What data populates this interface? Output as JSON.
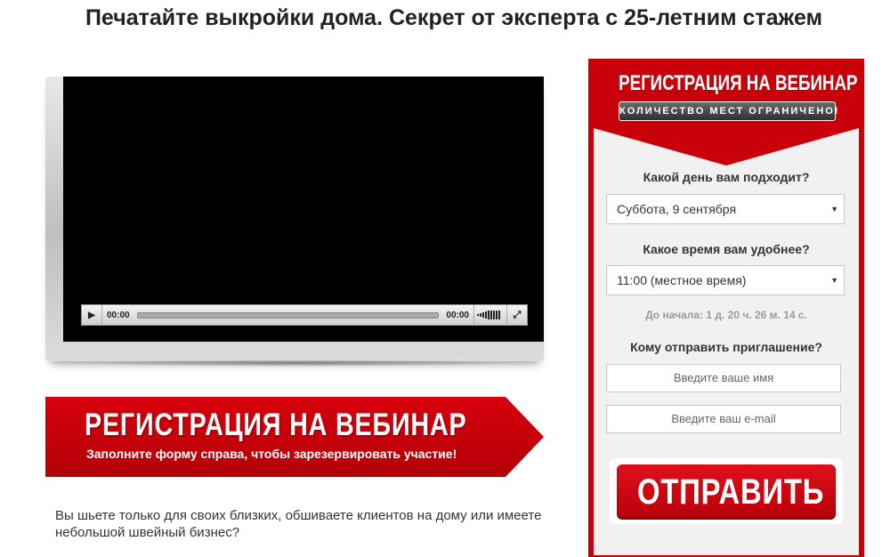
{
  "headline": "Печатайте выкройки дома. Секрет от эксперта с 25-летним стажем",
  "video": {
    "time_current": "00:00",
    "time_total": "00:00",
    "play_icon": "play-icon",
    "volume_icon": "volume-icon",
    "fullscreen_icon": "fullscreen-icon"
  },
  "banner": {
    "title": "РЕГИСТРАЦИЯ НА ВЕБИНАР",
    "subtitle": "Заполните форму справа, чтобы зарезервировать участие!",
    "color": "#c8000a"
  },
  "intro": "Вы шьете только для своих близких, обшиваете клиентов на дому или имеете небольшой швейный бизнес?",
  "form": {
    "title": "РЕГИСТРАЦИЯ НА ВЕБИНАР",
    "badge": "КОЛИЧЕСТВО МЕСТ ОГРАНИЧЕНО!",
    "day_label": "Какой день вам подходит?",
    "day_value": "Суббота, 9 сентября",
    "time_label": "Какое время вам удобнее?",
    "time_value": "11:00 (местное время)",
    "countdown": "До начала: 1 д. 20 ч. 26 м. 14 с.",
    "invite_label": "Кому отправить приглашение?",
    "name_placeholder": "Введите ваше имя",
    "email_placeholder": "Введите ваш e-mail",
    "submit_label": "ОТПРАВИТЬ",
    "accent_color": "#c8000a"
  }
}
